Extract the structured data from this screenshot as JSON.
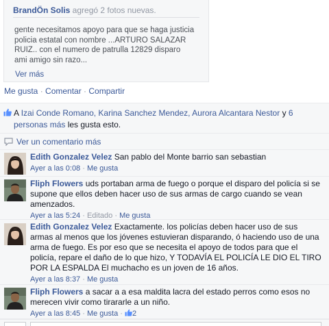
{
  "shared_post": {
    "author": "BrandÖn Solis",
    "action": " agregó 2 fotos nuevas.",
    "text_lines": [
      "gente necesitamos apoyo para que se haga justicia",
      "policia estatal con nombre ...ARTURO SALAZAR",
      "RUIZ.. con el numero de patrulla 12829 disparo",
      "ami amigo sin razo..."
    ],
    "see_more": "Ver más"
  },
  "actions": {
    "like": "Me gusta",
    "comment": "Comentar",
    "share": "Compartir",
    "separator": " · "
  },
  "likes": {
    "prefix": "A ",
    "names": "Izai Conde Romano, Karina Sanchez Mendez, Aurora Alcantara Nestor",
    "connector": " y ",
    "others": "6 personas más",
    "suffix": " les gusta esto."
  },
  "view_more": {
    "label": "Ver un comentario más"
  },
  "comments": [
    {
      "name": "Edith Gonzalez Velez",
      "text": "San pablo del Monte barrio san sebastian",
      "time": "Ayer a las 0:08",
      "like": "Me gusta"
    },
    {
      "name": "Fliph Flowers",
      "text": "uds portaban arma de fuego o porque el disparo del policía si se supone que ellos deben hacer uso de sus armas de cargo cuando se vean amenzados.",
      "time": "Ayer a las 5:24",
      "edited": "Editado",
      "like": "Me gusta"
    },
    {
      "name": "Edith Gonzalez Velez",
      "text": "Exactamente. los policías deben hacer uso de sus armas al menos que los jóvenes estuvieran disparando, ó haciendo uso de una arma de fuego. Es por eso que se necesita el apoyo de todos para que el policía, repare el daño de lo que hizo, Y TODAVÍA EL POLICÍA LE DIO EL TIRO POR LA ESPALDA El muchacho es un joven de 16 años.",
      "time": "Ayer a las 8:37",
      "like": "Me gusta"
    },
    {
      "name": "Fliph Flowers",
      "text": "a sacar a a esa maldita lacra del estado perros como esos no merecen vivir como tirararle a un niño.",
      "time": "Ayer a las 8:45",
      "like": "Me gusta",
      "like_count": "2"
    }
  ],
  "colors": {
    "link": "#3b5998",
    "muted": "#9197a3",
    "panel_bg": "#f6f7f8",
    "border": "#e9eaed"
  },
  "icons": {
    "likes": "thumbs-up-icon",
    "view_more": "comment-bubble-icon",
    "comment_likes": "thumbs-up-icon"
  }
}
